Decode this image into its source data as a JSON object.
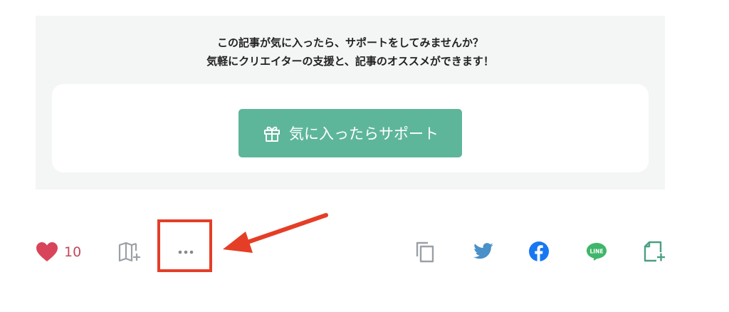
{
  "support": {
    "message_line1": "この記事が気に入ったら、サポートをしてみませんか？",
    "message_line2": "気軽にクリエイターの支援と、記事のオススメができます！",
    "button_label": "気に入ったらサポート",
    "accent_color": "#5eb69a"
  },
  "actions": {
    "like_count": "10",
    "icons": [
      "heart-icon",
      "magazine-add-icon",
      "more-icon",
      "copy-link-icon",
      "twitter-icon",
      "facebook-icon",
      "line-icon",
      "note-add-icon"
    ]
  },
  "annotation": {
    "color": "#e53e27"
  }
}
